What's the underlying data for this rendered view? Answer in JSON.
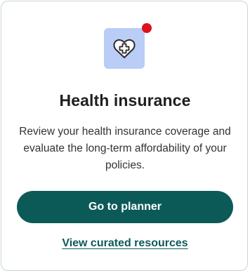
{
  "card": {
    "icon": "heart-with-medical-cross-icon",
    "has_notification": true,
    "title": "Health insurance",
    "description": "Review your health insurance coverage and evaluate the long-term affordability of your policies.",
    "primary_button_label": "Go to planner",
    "secondary_link_label": "View curated resources"
  },
  "colors": {
    "accent": "#0c5a58",
    "icon_tile_bg": "#b9cdf6",
    "notification": "#e0101c",
    "title_text": "#1f1f1f",
    "body_text": "#333333"
  }
}
